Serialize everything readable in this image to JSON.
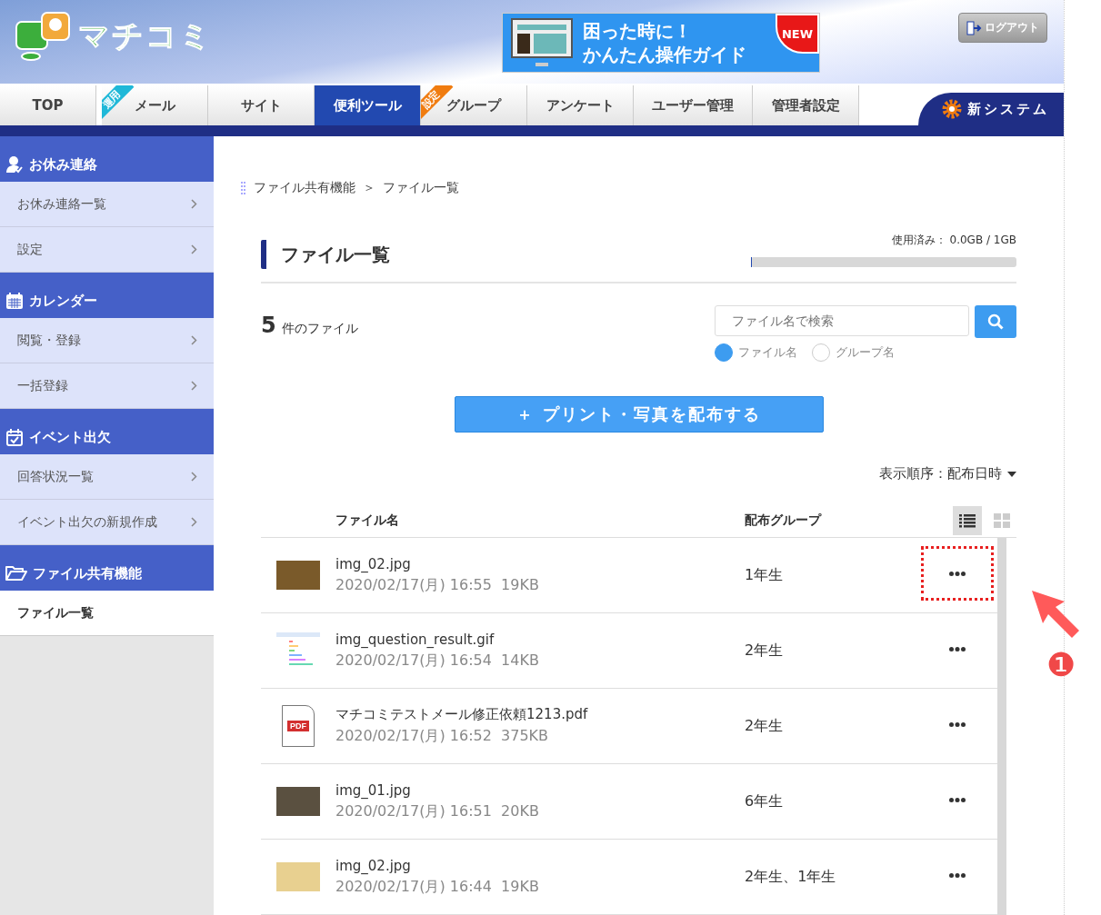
{
  "header": {
    "logo": "マチコミ",
    "banner": {
      "line1": "困った時に！",
      "line2": "かんたん操作ガイド",
      "badge": "NEW"
    },
    "logout": "ログアウト"
  },
  "nav": {
    "tabs": [
      {
        "label": "TOP",
        "selected": false
      },
      {
        "label": "メール",
        "ribbon": {
          "text": "運用",
          "color": "#1fb8d8"
        },
        "selected": false
      },
      {
        "label": "サイト",
        "selected": false
      },
      {
        "label": "便利ツール",
        "selected": true
      },
      {
        "label": "グループ",
        "ribbon": {
          "text": "設定",
          "color": "#f07c10"
        },
        "selected": false
      },
      {
        "label": "アンケート",
        "selected": false
      },
      {
        "label": "ユーザー管理",
        "selected": false
      },
      {
        "label": "管理者設定",
        "selected": false
      }
    ],
    "new_system": "新システム"
  },
  "sidebar": {
    "sections": [
      {
        "title": "お休み連絡",
        "items": [
          {
            "label": "お休み連絡一覧",
            "selected": false
          },
          {
            "label": "設定",
            "selected": false
          }
        ]
      },
      {
        "title": "カレンダー",
        "items": [
          {
            "label": "閲覧・登録",
            "selected": false
          },
          {
            "label": "一括登録",
            "selected": false
          }
        ]
      },
      {
        "title": "イベント出欠",
        "items": [
          {
            "label": "回答状況一覧",
            "selected": false
          },
          {
            "label": "イベント出欠の新規作成",
            "selected": false
          }
        ]
      },
      {
        "title": "ファイル共有機能",
        "items": [
          {
            "label": "ファイル一覧",
            "selected": true
          }
        ]
      }
    ]
  },
  "breadcrumb": [
    "ファイル共有機能",
    "＞",
    "ファイル一覧"
  ],
  "page_title": "ファイル一覧",
  "usage": {
    "label": "使用済み：",
    "value": "0.0GB / 1GB",
    "level": 0.005
  },
  "count": {
    "number": "5",
    "label": "件のファイル"
  },
  "search": {
    "placeholder": "ファイル名で検索",
    "options": [
      {
        "label": "ファイル名",
        "selected": true
      },
      {
        "label": "グループ名",
        "selected": false
      }
    ]
  },
  "distribute_button": "＋ プリント・写真を配布する",
  "sort": {
    "label": "表示順序：配布日時"
  },
  "table": {
    "columns": [
      "ファイル名",
      "配布グループ"
    ],
    "views": [
      {
        "kind": "list",
        "selected": true
      },
      {
        "kind": "grid",
        "selected": false
      }
    ],
    "rows": [
      {
        "kind": "photo",
        "name": "img_02.jpg",
        "meta": "2020/02/17(月) 16:55  19KB",
        "group": "1年生",
        "highlighted": true
      },
      {
        "kind": "chart",
        "name": "img_question_result.gif",
        "meta": "2020/02/17(月) 16:54  14KB",
        "group": "2年生",
        "highlighted": false
      },
      {
        "kind": "document",
        "badge": "PDF",
        "name": "マチコミテストメール修正依頼1213.pdf",
        "meta": "2020/02/17(月) 16:52  375KB",
        "group": "2年生",
        "highlighted": false
      },
      {
        "kind": "photo",
        "name": "img_01.jpg",
        "meta": "2020/02/17(月) 16:51  20KB",
        "group": "6年生",
        "highlighted": false
      },
      {
        "kind": "photo",
        "name": "img_02.jpg",
        "meta": "2020/02/17(月) 16:44  19KB",
        "group": "2年生、1年生",
        "highlighted": false
      }
    ]
  },
  "callout": "❶"
}
